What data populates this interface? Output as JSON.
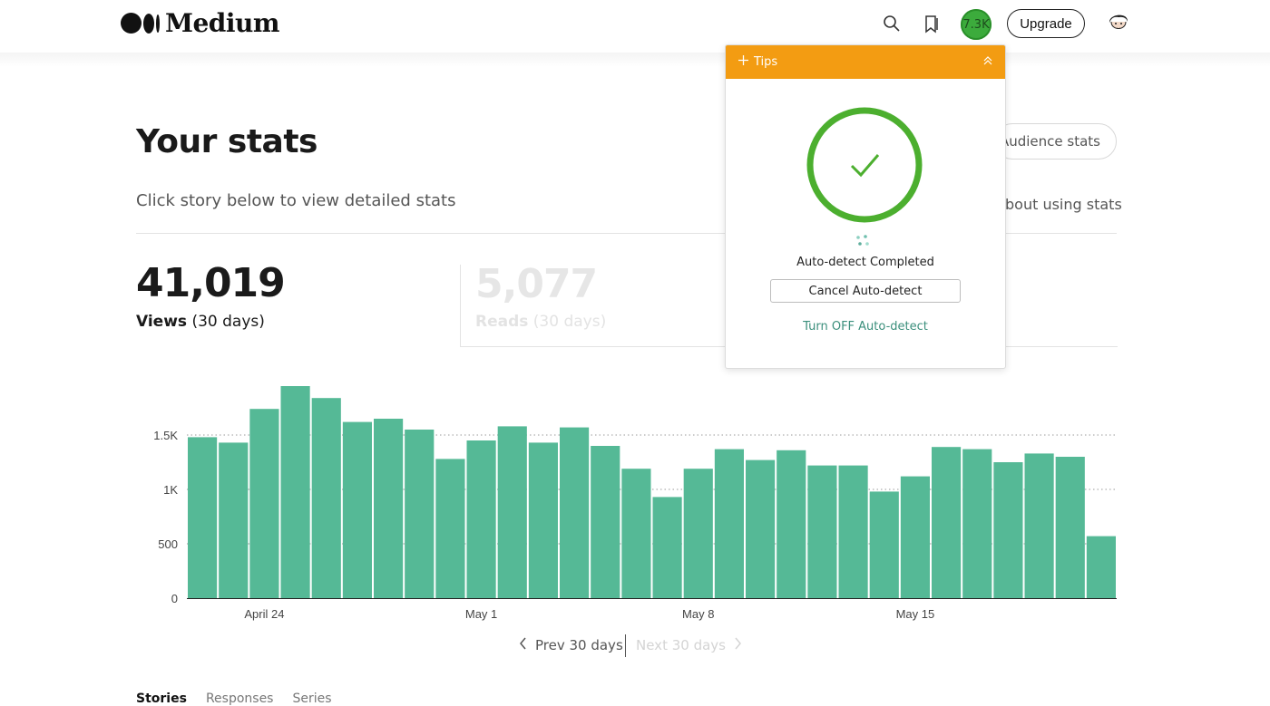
{
  "header": {
    "logo_text": "Medium",
    "notifications_count": "7.3K",
    "upgrade_label": "Upgrade",
    "icons": [
      "search-icon",
      "bookmark-icon",
      "user-avatar"
    ]
  },
  "page": {
    "title": "Your stats",
    "subtitle": "Click story below to view detailed stats",
    "audience_button": "Audience stats",
    "learn_link": "bout using stats"
  },
  "stats": {
    "views_value": "41,019",
    "views_label": "Views",
    "views_period": " (30 days)",
    "reads_value": "5,077",
    "reads_label": "Reads",
    "reads_period": " (30 days)"
  },
  "chart_data": {
    "type": "bar",
    "x_tick_labels": [
      "April 24",
      "May 1",
      "May 8",
      "May 15"
    ],
    "y_ticks": [
      "0",
      "500",
      "1K",
      "1.5K"
    ],
    "ylim": [
      0,
      2000
    ],
    "grid": "dotted horizontal",
    "values": [
      1480,
      1430,
      1740,
      1950,
      1840,
      1620,
      1650,
      1550,
      1280,
      1450,
      1580,
      1430,
      1570,
      1400,
      1190,
      930,
      1190,
      1370,
      1270,
      1360,
      1220,
      1220,
      980,
      1120,
      1390,
      1370,
      1250,
      1330,
      1300,
      570
    ],
    "color": "#55b996"
  },
  "pager": {
    "prev_label": "Prev 30 days",
    "next_label": "Next 30 days"
  },
  "tabs": [
    "Stories",
    "Responses",
    "Series"
  ],
  "popup": {
    "header_label": "Tips",
    "status_text": "Auto-detect Completed",
    "cancel_label": "Cancel Auto-detect",
    "link_label": "Turn OFF Auto-detect",
    "accent_color": "#f39c12",
    "ring_color": "#4caf2f"
  }
}
